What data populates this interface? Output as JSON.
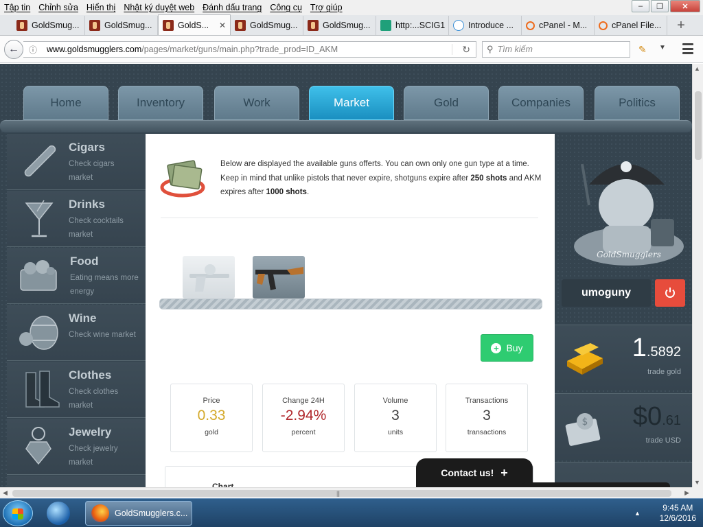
{
  "browser": {
    "menu": [
      "Tập tin",
      "Chỉnh sửa",
      "Hiển thị",
      "Nhật ký duyệt web",
      "Đánh dấu trang",
      "Công cụ",
      "Trợ giúp"
    ],
    "tabs": [
      {
        "label": "GoldSmug...",
        "favicon": "goldsmugglers-icon"
      },
      {
        "label": "GoldSmug...",
        "favicon": "goldsmugglers-icon"
      },
      {
        "label": "GoldS...",
        "favicon": "goldsmugglers-icon",
        "active": true
      },
      {
        "label": "GoldSmug...",
        "favicon": "goldsmugglers-icon"
      },
      {
        "label": "GoldSmug...",
        "favicon": "goldsmugglers-icon"
      },
      {
        "label": "http:...SCIG1",
        "favicon": "scig-icon"
      },
      {
        "label": "Introduce ...",
        "favicon": "intro-icon"
      },
      {
        "label": "cPanel - M...",
        "favicon": "cpanel-icon"
      },
      {
        "label": "cPanel File...",
        "favicon": "cpanel-icon"
      }
    ],
    "url_host": "www.goldsmugglers.com",
    "url_path": "/pages/market/guns/main.php?trade_prod=ID_AKM",
    "search_placeholder": "Tìm kiếm"
  },
  "site": {
    "nav": [
      "Home",
      "Inventory",
      "Work",
      "Market",
      "Gold",
      "Companies",
      "Politics"
    ],
    "active_nav": "Market",
    "sidebar": [
      {
        "title": "Cigars",
        "sub": "Check cigars market",
        "icon": "cigar-icon"
      },
      {
        "title": "Drinks",
        "sub": "Check cocktails market",
        "icon": "cocktail-icon"
      },
      {
        "title": "Food",
        "sub": "Eating means more energy",
        "icon": "food-basket-icon"
      },
      {
        "title": "Wine",
        "sub": "Check wine market",
        "icon": "wine-barrel-icon"
      },
      {
        "title": "Clothes",
        "sub": "Check clothes market",
        "icon": "boots-icon"
      },
      {
        "title": "Jewelry",
        "sub": "Check jewelry market",
        "icon": "jewelry-icon"
      }
    ],
    "intro": {
      "text_1": "Below are displayed the available guns offerts. You can own only one gun type at a time. Keep in mind that unlike pistols that never expire, shotguns expire after ",
      "bold_1": "250 shots",
      "text_2": " and AKM expires after ",
      "bold_2": "1000 shots",
      "text_3": "."
    },
    "buy_label": "Buy",
    "stats": [
      {
        "label": "Price",
        "value": "0.33",
        "unit": "gold",
        "color": "#d4a92a"
      },
      {
        "label": "Change 24H",
        "value": "-2.94%",
        "unit": "percent",
        "color": "#b0272b"
      },
      {
        "label": "Volume",
        "value": "3",
        "unit": "units",
        "color": "#444444"
      },
      {
        "label": "Transactions",
        "value": "3",
        "unit": "transactions",
        "color": "#444444"
      }
    ],
    "chart_title": "Chart",
    "user": {
      "name": "umoguny"
    },
    "balances": [
      {
        "int": "1",
        "dec": ".5892",
        "caption": "trade gold",
        "icon": "gold-bar-icon"
      },
      {
        "int": "$0",
        "dec": ".61",
        "caption": "trade USD",
        "icon": "money-envelope-icon"
      }
    ],
    "contact_label": "Contact us!"
  },
  "taskbar": {
    "app_label": "GoldSmugglers.c...",
    "time": "9:45 AM",
    "date": "12/6/2016"
  }
}
